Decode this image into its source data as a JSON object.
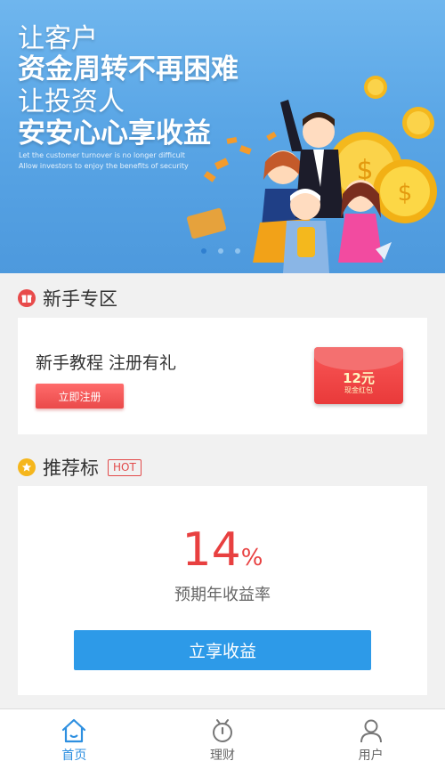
{
  "banner": {
    "line1": "让客户",
    "line2": "资金周转不再困难",
    "line3": "让投资人",
    "line4": "安安心心享收益",
    "sub1": "Let the customer turnover is no longer difficult",
    "sub2": "Allow investors to enjoy the benefits of security"
  },
  "newbie": {
    "title": "新手专区",
    "card_title": "新手教程 注册有礼",
    "register_label": "立即注册",
    "envelope_amount": "12元",
    "envelope_label": "现金红包"
  },
  "recommend": {
    "title": "推荐标",
    "badge": "HOT",
    "rate_value": "14",
    "rate_unit": "%",
    "rate_label": "预期年收益率",
    "invest_label": "立享收益"
  },
  "tabbar": {
    "items": [
      {
        "label": "首页",
        "icon": "home-icon"
      },
      {
        "label": "理财",
        "icon": "finance-icon"
      },
      {
        "label": "用户",
        "icon": "user-icon"
      }
    ],
    "active": 0
  },
  "colors": {
    "accent": "#2d9ae8",
    "red": "#e84040",
    "banner": "#5aa6e6"
  }
}
